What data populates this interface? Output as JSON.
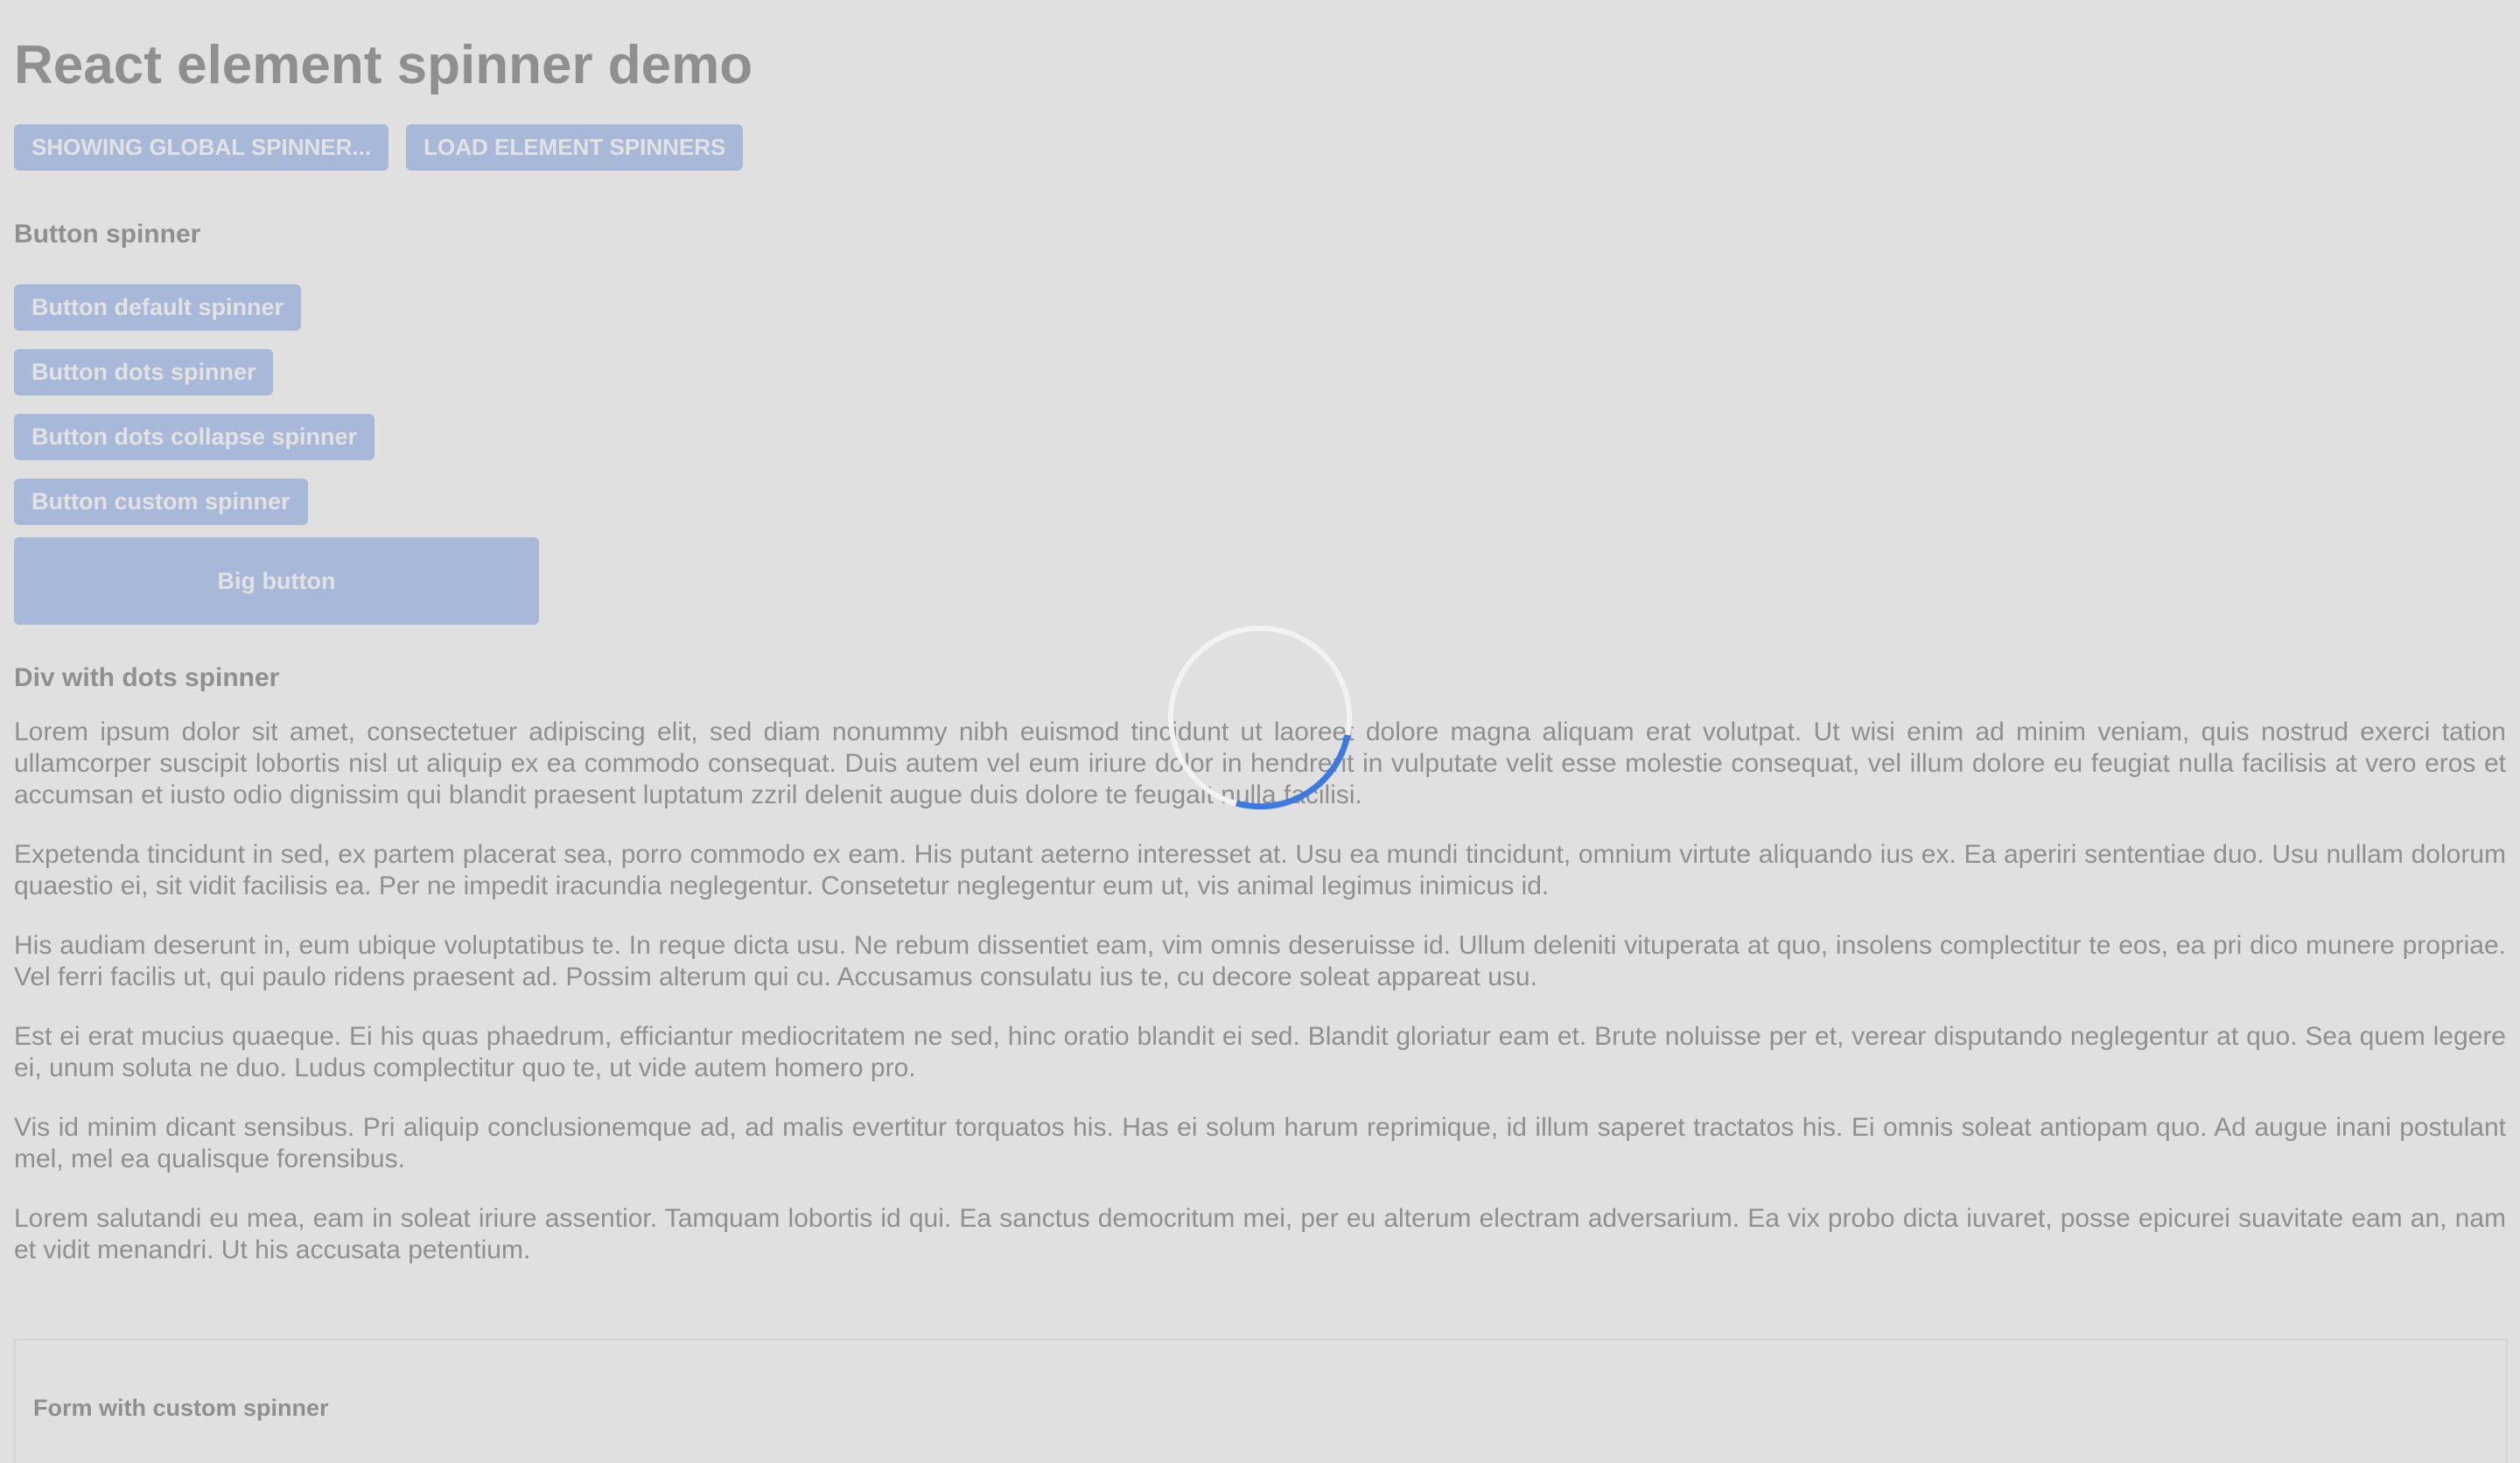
{
  "header": {
    "title": "React element spinner demo"
  },
  "toolbar": {
    "global_spinner_label": "Showing global spinner...",
    "load_element_spinners_label": "Load element spinners"
  },
  "button_section": {
    "heading": "Button spinner",
    "buttons": [
      "Button default spinner",
      "Button dots spinner",
      "Button dots collapse spinner",
      "Button custom spinner"
    ],
    "big_button_label": "Big button"
  },
  "div_section": {
    "heading": "Div with dots spinner",
    "paragraphs": [
      "Lorem ipsum dolor sit amet, consectetuer adipiscing elit, sed diam nonummy nibh euismod tincidunt ut laoreet dolore magna aliquam erat volutpat. Ut wisi enim ad minim veniam, quis nostrud exerci tation ullamcorper suscipit lobortis nisl ut aliquip ex ea commodo consequat. Duis autem vel eum iriure dolor in hendrerit in vulputate velit esse molestie consequat, vel illum dolore eu feugiat nulla facilisis at vero eros et accumsan et iusto odio dignissim qui blandit praesent luptatum zzril delenit augue duis dolore te feugait nulla facilisi.",
      "Expetenda tincidunt in sed, ex partem placerat sea, porro commodo ex eam. His putant aeterno interesset at. Usu ea mundi tincidunt, omnium virtute aliquando ius ex. Ea aperiri sententiae duo. Usu nullam dolorum quaestio ei, sit vidit facilisis ea. Per ne impedit iracundia neglegentur. Consetetur neglegentur eum ut, vis animal legimus inimicus id.",
      "His audiam deserunt in, eum ubique voluptatibus te. In reque dicta usu. Ne rebum dissentiet eam, vim omnis deseruisse id. Ullum deleniti vituperata at quo, insolens complectitur te eos, ea pri dico munere propriae. Vel ferri facilis ut, qui paulo ridens praesent ad. Possim alterum qui cu. Accusamus consulatu ius te, cu decore soleat appareat usu.",
      "Est ei erat mucius quaeque. Ei his quas phaedrum, efficiantur mediocritatem ne sed, hinc oratio blandit ei sed. Blandit gloriatur eam et. Brute noluisse per et, verear disputando neglegentur at quo. Sea quem legere ei, unum soluta ne duo. Ludus complectitur quo te, ut vide autem homero pro.",
      "Vis id minim dicant sensibus. Pri aliquip conclusionemque ad, ad malis evertitur torquatos his. Has ei solum harum reprimique, id illum saperet tractatos his. Ei omnis soleat antiopam quo. Ad augue inani postulant mel, mel ea qualisque forensibus.",
      "Lorem salutandi eu mea, eam in soleat iriure assentior. Tamquam lobortis id qui. Ea sanctus democritum mei, per eu alterum electram adversarium. Ea vix probo dicta iuvaret, posse epicurei suavitate eam an, nam et vidit menandri. Ut his accusata petentium."
    ]
  },
  "form_section": {
    "heading": "Form with custom spinner"
  },
  "global_spinner": {
    "icon": "loading-spinner-icon",
    "track_color": "#f2f2f2",
    "arc_color": "#3b7ae0"
  }
}
